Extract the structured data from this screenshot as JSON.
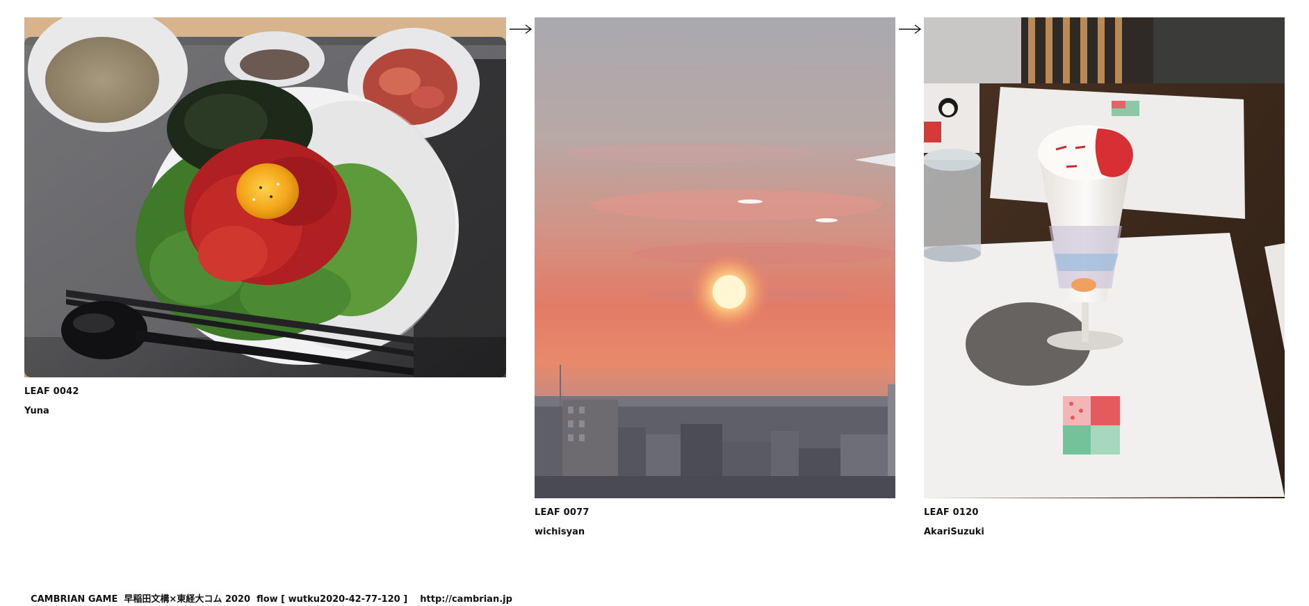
{
  "leaves": [
    {
      "id": "LEAF 0042",
      "author": "Yuna",
      "subject": "yukhoe-bowl-photo"
    },
    {
      "id": "LEAF 0077",
      "author": "wichisyan",
      "subject": "sunset-cityscape-photo"
    },
    {
      "id": "LEAF 0120",
      "author": "AkariSuzuki",
      "subject": "parfait-cafe-photo"
    }
  ],
  "arrows": [
    "right-arrow-icon",
    "right-arrow-icon"
  ],
  "footer": {
    "text": "CAMBRIAN GAME  早稲田文構×東経大コム 2020  flow [ wutku2020-42-77-120 ]",
    "url": "http://cambrian.jp"
  },
  "colors": {
    "background": "#ffffff",
    "text": "#111111"
  }
}
